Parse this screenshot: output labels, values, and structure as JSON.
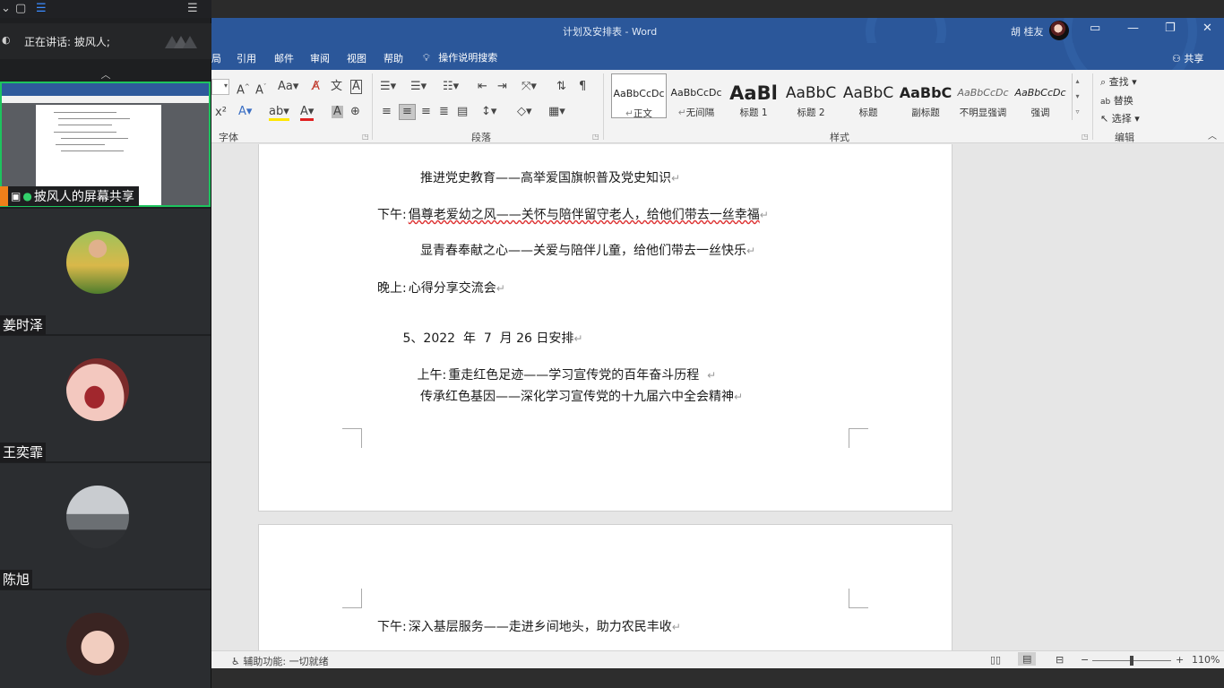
{
  "meeting": {
    "speaking_label": "正在讲话: 披风人;",
    "share_label": "披风人的屏幕共享",
    "participants": [
      {
        "name": "姜时泽"
      },
      {
        "name": "王奕霏"
      },
      {
        "name": "陈旭"
      },
      {
        "name": ""
      }
    ]
  },
  "word": {
    "title": "计划及安排表 - Word",
    "user_name": "胡 桂友",
    "menu": [
      "局",
      "引用",
      "邮件",
      "审阅",
      "视图",
      "帮助"
    ],
    "tell_me": "操作说明搜索",
    "share": "共享",
    "ribbon": {
      "groups": [
        "字体",
        "段落",
        "样式",
        "编辑"
      ],
      "styles": [
        {
          "preview": "AaBbCcDc",
          "name": "正文"
        },
        {
          "preview": "AaBbCcDc",
          "name": "无间隔"
        },
        {
          "preview": "AaBl",
          "name": "标题 1"
        },
        {
          "preview": "AaBbC",
          "name": "标题 2"
        },
        {
          "preview": "AaBbC",
          "name": "标题"
        },
        {
          "preview": "AaBbC",
          "name": "副标题"
        },
        {
          "preview": "AaBbCcDc",
          "name": "不明显强调"
        },
        {
          "preview": "AaBbCcDc",
          "name": "强调"
        }
      ],
      "editing": [
        "查找",
        "替换",
        "选择"
      ]
    },
    "document": {
      "page1_lines": [
        {
          "prefix": "",
          "text": "推进党史教育——高举爱国旗帜普及党史知识"
        },
        {
          "prefix": "下午:",
          "text": "倡尊老爱幼之风——关怀与陪伴留守老人，给他们带去一丝幸福"
        },
        {
          "prefix": "",
          "text": "显青春奉献之心——关爱与陪伴儿童，给他们带去一丝快乐"
        },
        {
          "prefix": "晚上:",
          "text": "心得分享交流会"
        },
        {
          "prefix": "",
          "text": "5、2022  年  7  月 26 日安排"
        },
        {
          "prefix": "上午:",
          "text": "重走红色足迹——学习宣传党的百年奋斗历程  "
        },
        {
          "prefix": "",
          "text": "传承红色基因——深化学习宣传党的十九届六中全会精神"
        }
      ],
      "page2_lines": [
        {
          "prefix": "下午:",
          "text": "深入基层服务——走进乡间地头，助力农民丰收"
        }
      ],
      "para_mark": "↵"
    },
    "status": {
      "accessibility": "辅助功能: 一切就绪",
      "zoom": "110%"
    }
  }
}
